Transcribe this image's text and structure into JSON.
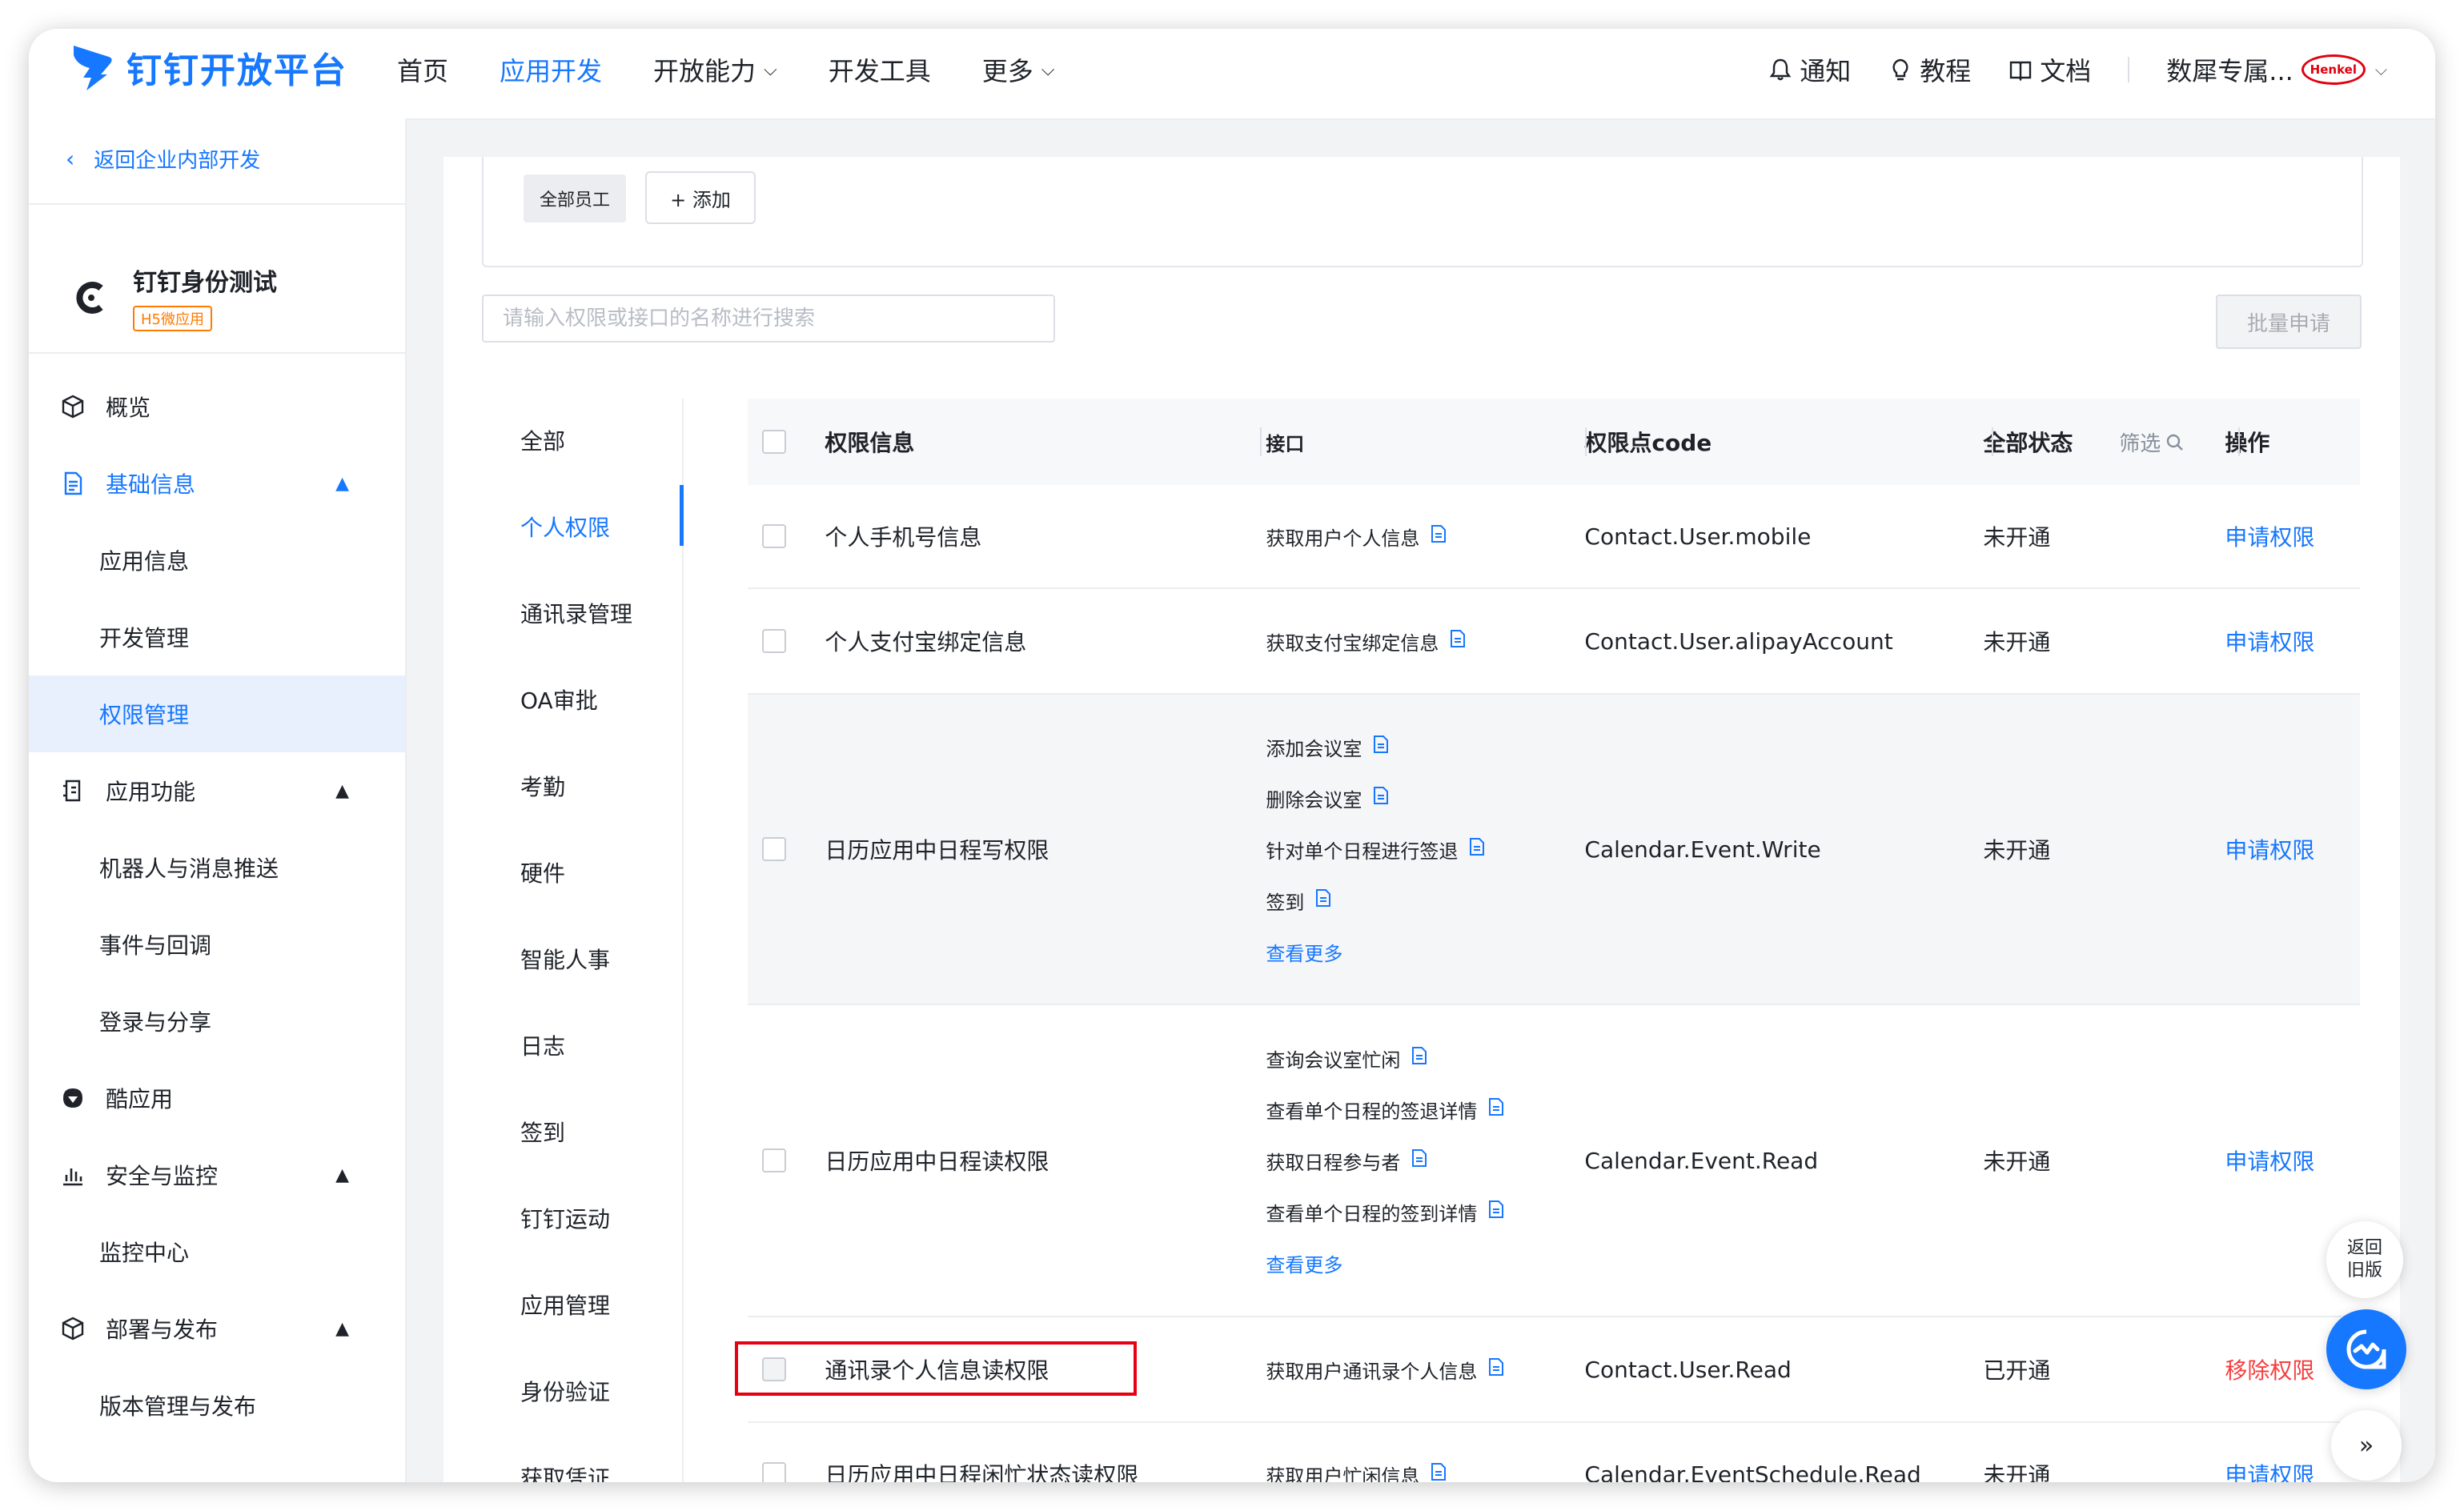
{
  "header": {
    "logo_text": "钉钉开放平台",
    "nav": [
      {
        "label": "首页",
        "chevron": ""
      },
      {
        "label": "应用开发",
        "chevron": ""
      },
      {
        "label": "开放能力",
        "chevron": "⌵"
      },
      {
        "label": "开发工具",
        "chevron": ""
      },
      {
        "label": "更多",
        "chevron": "⌵"
      }
    ],
    "notify": "通知",
    "tutorial": "教程",
    "docs": "文档",
    "org_name": "数犀专属...",
    "org_logo_text": "Henkel",
    "org_chevron": "⌵"
  },
  "sidebar": {
    "back_label": "返回企业内部开发",
    "back_icon": "chevron-left-icon",
    "app_name": "钉钉身份测试",
    "app_tag": "H5微应用",
    "menu": [
      {
        "label": "概览",
        "icon": "cube-icon"
      },
      {
        "label": "基础信息",
        "icon": "document-icon",
        "caret": "▲"
      },
      {
        "label": "应用信息"
      },
      {
        "label": "开发管理"
      },
      {
        "label": "权限管理"
      },
      {
        "label": "应用功能",
        "icon": "feature-icon",
        "caret": "▲"
      },
      {
        "label": "机器人与消息推送"
      },
      {
        "label": "事件与回调"
      },
      {
        "label": "登录与分享"
      },
      {
        "label": "酷应用",
        "icon": "cool-app-icon"
      },
      {
        "label": "安全与监控",
        "icon": "bar-chart-icon",
        "caret": "▲"
      },
      {
        "label": "监控中心"
      },
      {
        "label": "部署与发布",
        "icon": "cube-icon",
        "caret": "▲"
      },
      {
        "label": "版本管理与发布"
      }
    ]
  },
  "scope": {
    "pill": "全部员工",
    "add_label": "+ 添加"
  },
  "search": {
    "placeholder": "请输入权限或接口的名称进行搜索"
  },
  "batch_button": "批量申请",
  "categories": [
    "全部",
    "个人权限",
    "通讯录管理",
    "OA审批",
    "考勤",
    "硬件",
    "智能人事",
    "日志",
    "签到",
    "钉钉运动",
    "应用管理",
    "身份验证",
    "获取凭证"
  ],
  "table": {
    "headers": {
      "info": "权限信息",
      "api": "接口",
      "code": "权限点code",
      "status": "全部状态",
      "filter": "筛选",
      "op": "操作"
    },
    "rows": [
      {
        "name": "个人手机号信息",
        "apis": [
          "获取用户个人信息"
        ],
        "more": "",
        "code": "Contact.User.mobile",
        "status": "未开通",
        "op": "申请权限"
      },
      {
        "name": "个人支付宝绑定信息",
        "apis": [
          "获取支付宝绑定信息"
        ],
        "more": "",
        "code": "Contact.User.alipayAccount",
        "status": "未开通",
        "op": "申请权限"
      },
      {
        "name": "日历应用中日程写权限",
        "apis": [
          "添加会议室",
          "删除会议室",
          "针对单个日程进行签退",
          "签到"
        ],
        "more": "查看更多",
        "code": "Calendar.Event.Write",
        "status": "未开通",
        "op": "申请权限"
      },
      {
        "name": "日历应用中日程读权限",
        "apis": [
          "查询会议室忙闲",
          "查看单个日程的签退详情",
          "获取日程参与者",
          "查看单个日程的签到详情"
        ],
        "more": "查看更多",
        "code": "Calendar.Event.Read",
        "status": "未开通",
        "op": "申请权限"
      },
      {
        "name": "通讯录个人信息读权限",
        "apis": [
          "获取用户通讯录个人信息"
        ],
        "more": "",
        "code": "Contact.User.Read",
        "status": "已开通",
        "op": "移除权限"
      },
      {
        "name": "日历应用中日程闲忙状态读权限",
        "apis": [
          "获取用户忙闲信息"
        ],
        "more": "",
        "code": "Calendar.EventSchedule.Read",
        "status": "未开通",
        "op": "申请权限"
      }
    ]
  },
  "float": {
    "old_version": "返回\n旧版",
    "help_icon": "assistant-icon",
    "expand": "»"
  },
  "colors": {
    "accent": "#1677ff",
    "danger": "#f53f3f",
    "highlight_box": "#e60012"
  }
}
